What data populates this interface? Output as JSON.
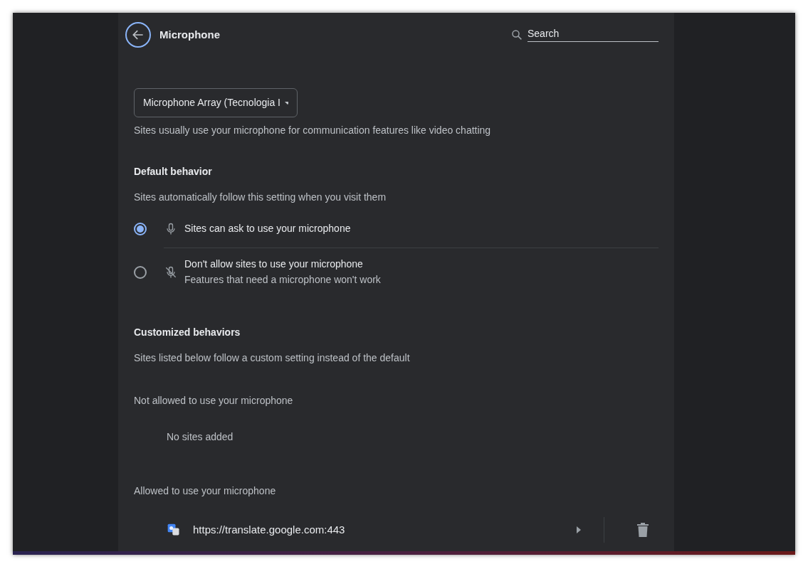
{
  "header": {
    "title": "Microphone",
    "search_placeholder": "Search"
  },
  "device_select": {
    "value": "Microphone Array (Tecnologia I"
  },
  "description": "Sites usually use your microphone for communication features like video chatting",
  "default_behavior": {
    "title": "Default behavior",
    "subtitle": "Sites automatically follow this setting when you visit them",
    "options": [
      {
        "kind": "mic",
        "label": "Sites can ask to use your microphone",
        "selected": true
      },
      {
        "kind": "mic-off",
        "label": "Don't allow sites to use your microphone",
        "sublabel": "Features that need a microphone won't work",
        "selected": false
      }
    ]
  },
  "customized_behaviors": {
    "title": "Customized behaviors",
    "subtitle": "Sites listed below follow a custom setting instead of the default",
    "groups": [
      {
        "title": "Not allowed to use your microphone",
        "empty_text": "No sites added"
      },
      {
        "title": "Allowed to use your microphone",
        "sites": [
          {
            "url": "https://translate.google.com:443"
          }
        ]
      }
    ]
  }
}
